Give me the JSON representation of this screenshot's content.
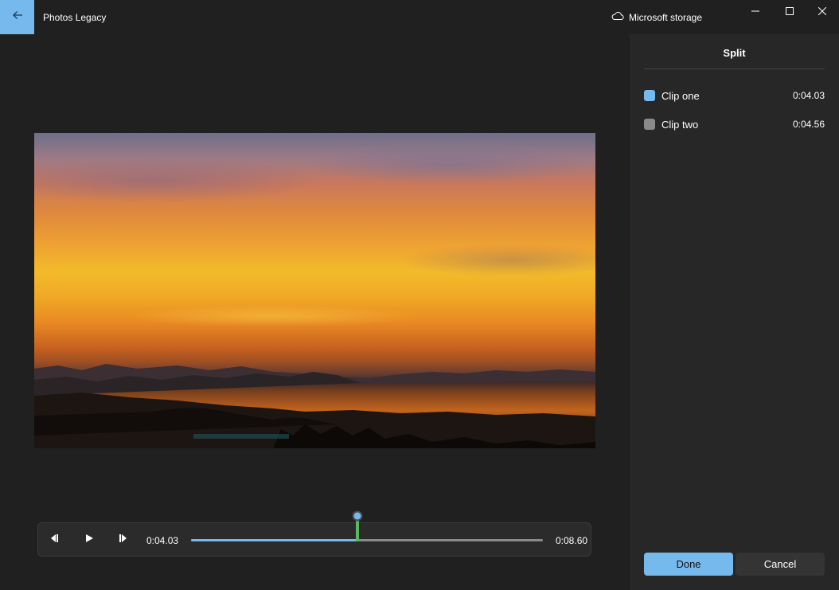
{
  "app": {
    "title": "Photos Legacy",
    "storage_label": "Microsoft storage"
  },
  "player": {
    "current_time": "0:04.03",
    "total_time": "0:08.60",
    "progress": 0.47
  },
  "panel": {
    "title": "Split",
    "clips": [
      {
        "label": "Clip one",
        "duration": "0:04.03",
        "color": "#76b9ed"
      },
      {
        "label": "Clip two",
        "duration": "0:04.56",
        "color": "#8a8a8a"
      }
    ],
    "done_label": "Done",
    "cancel_label": "Cancel"
  },
  "colors": {
    "accent": "#76b9ed",
    "background": "#202020",
    "panel": "#272727"
  }
}
